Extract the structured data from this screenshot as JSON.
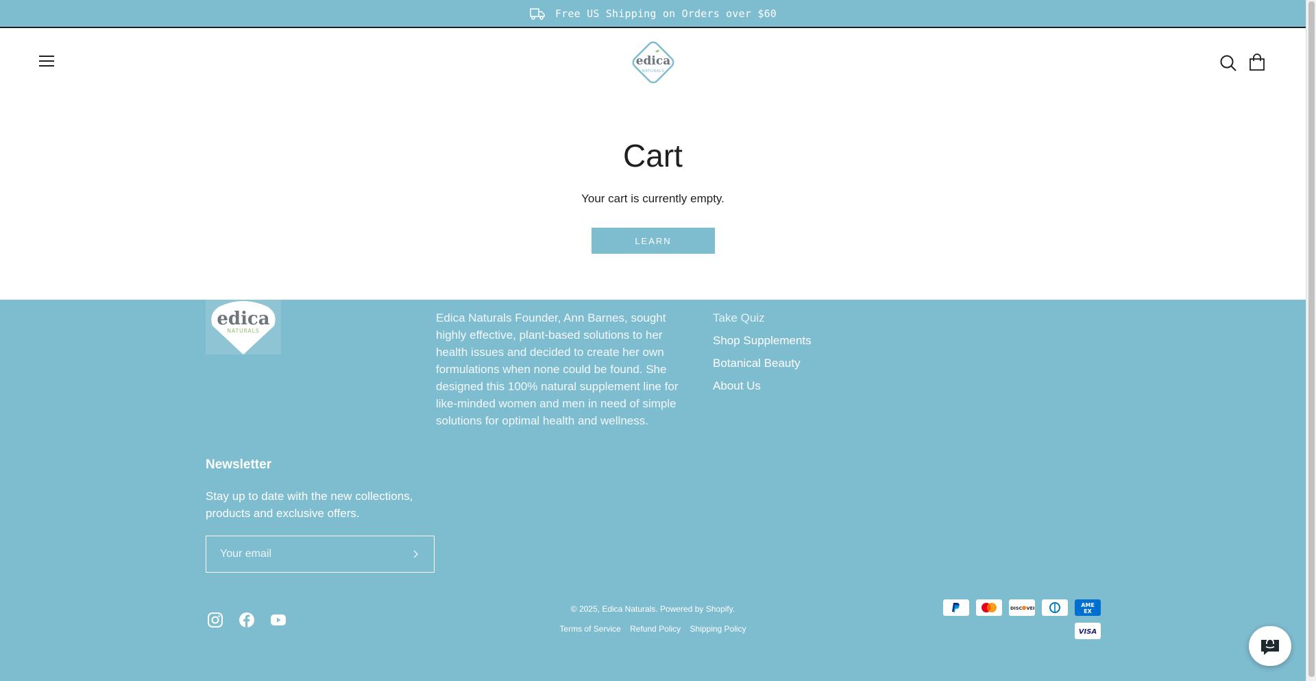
{
  "announcement": {
    "text": "Free US Shipping on Orders over $60",
    "icon": "truck-icon"
  },
  "header": {
    "menu_icon": "hamburger-menu-icon",
    "logo_alt": "Edica Naturals",
    "logo_text_top": "edica",
    "logo_text_bottom": "NATURALS",
    "search_icon": "search-icon",
    "cart_icon": "shopping-bag-icon"
  },
  "cart": {
    "title": "Cart",
    "empty_message": "Your cart is currently empty.",
    "button_label": "LEARN"
  },
  "footer": {
    "logo_text_top": "edica",
    "logo_text_bottom": "NATURALS",
    "about_text": "Edica Naturals Founder, Ann Barnes, sought highly effective, plant-based solutions to her health issues and decided to create her own formulations when none could be found. She designed this 100% natural supplement line for like-minded women and men in need of simple solutions for optimal health and wellness.",
    "links": [
      "Take Quiz",
      "Shop Supplements",
      "Botanical Beauty",
      "About Us"
    ],
    "newsletter": {
      "title": "Newsletter",
      "text": "Stay up to date with the new collections, products and exclusive offers.",
      "email_placeholder": "Your email"
    },
    "social": [
      "instagram-icon",
      "facebook-icon",
      "youtube-icon"
    ],
    "copyright": "© 2025, Edica Naturals. Powered by Shopify.",
    "policies": [
      "Terms of Service",
      "Refund Policy",
      "Shipping Policy"
    ],
    "payment_methods": [
      "PayPal",
      "Mastercard",
      "Discover",
      "Diners Club",
      "American Express",
      "Visa"
    ]
  },
  "colors": {
    "brand": "#7ebccf",
    "text": "#1f1f1f",
    "white": "#ffffff"
  }
}
